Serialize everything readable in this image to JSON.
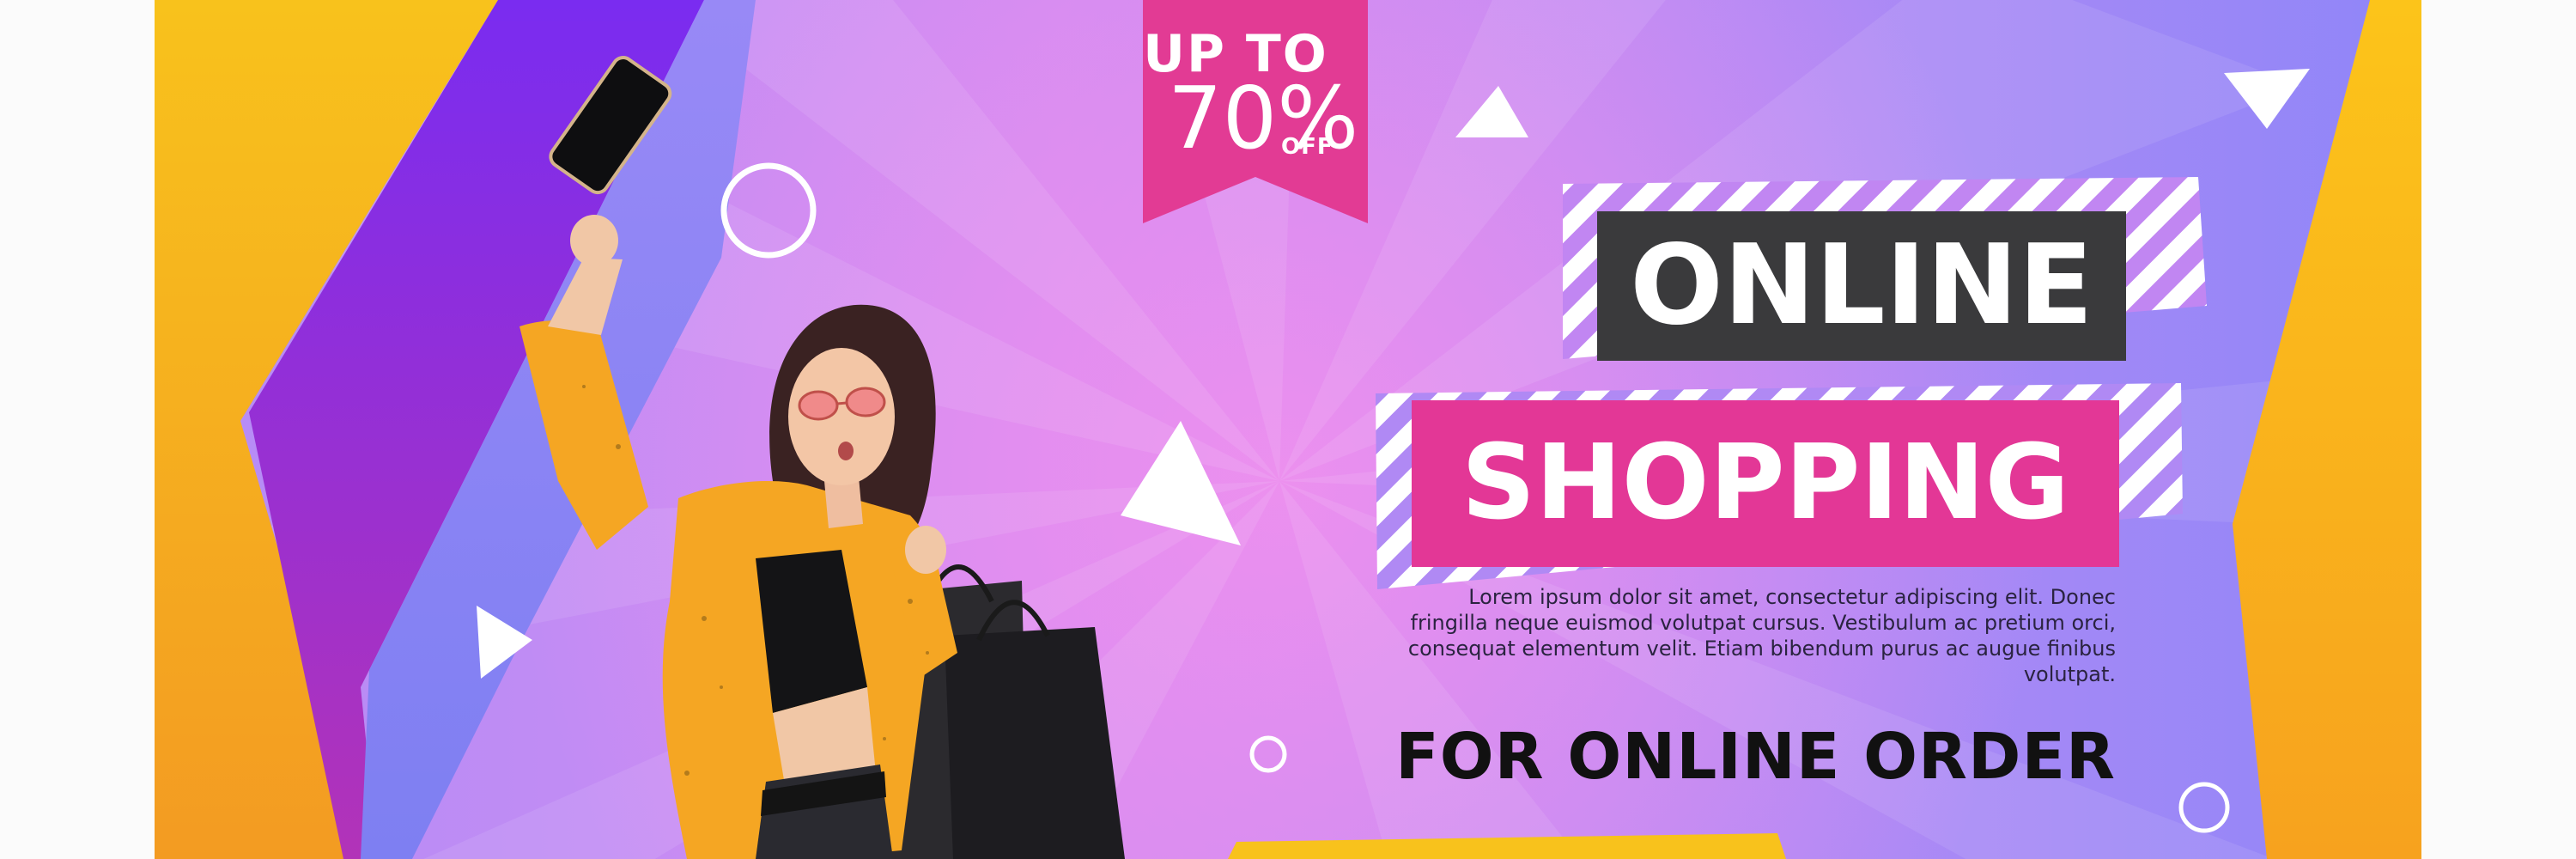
{
  "banner": {
    "badge": {
      "line1": "UP TO",
      "percent": "70%",
      "off": "OFF"
    },
    "headline": {
      "line1": "ONLINE",
      "line2": "SHOPPING"
    },
    "description": "Lorem ipsum dolor sit amet, consectetur adipiscing elit. Donec fringilla neque euismod volutpat cursus. Vestibulum ac pretium orci, consequat elementum velit. Etiam bibendum purus ac augue finibus volutpat.",
    "cta": "FOR ONLINE ORDER"
  },
  "colors": {
    "yellow": "#f8c21c",
    "purple": "#7f2de8",
    "pink": "#e33796",
    "dark": "#3b3b3b",
    "violet_bg": "#c58cf3",
    "jacket": "#f5a623"
  }
}
